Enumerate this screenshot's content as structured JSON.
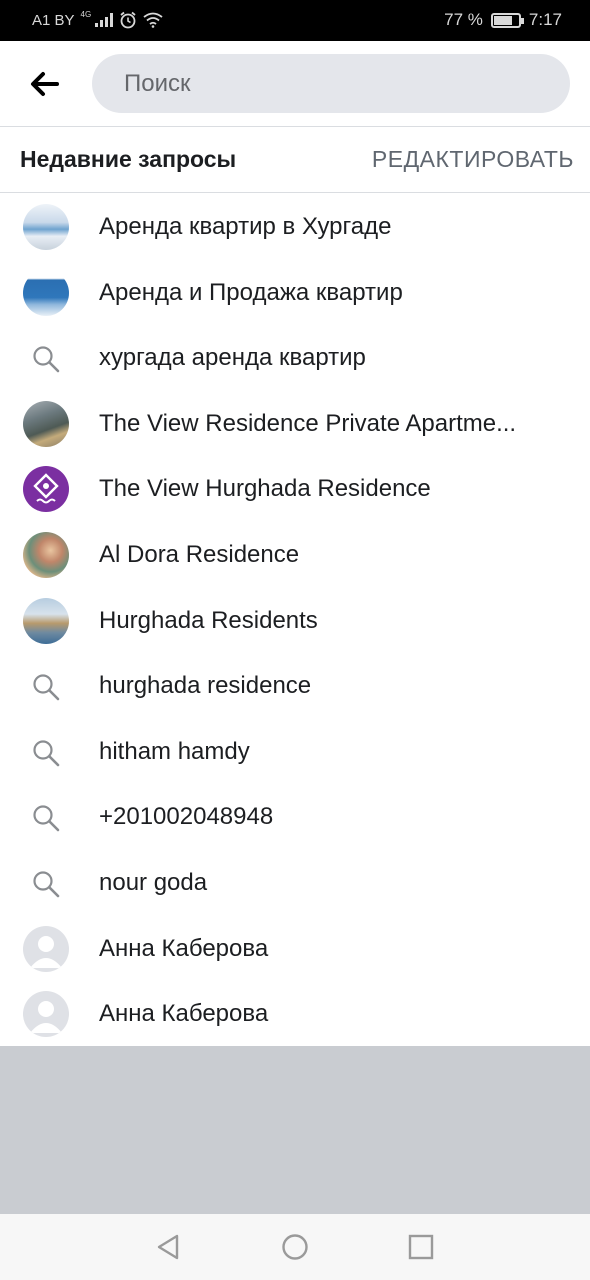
{
  "status_bar": {
    "carrier": "A1 BY",
    "network": "4G",
    "battery_percent": "77 %",
    "battery_level": 0.77,
    "time": "7:17",
    "icons": [
      "signal-icon",
      "alarm-icon",
      "wifi-icon",
      "battery-icon"
    ]
  },
  "search": {
    "back_icon": "arrow-left-icon",
    "placeholder": "Поиск",
    "value": ""
  },
  "recent": {
    "title": "Недавние запросы",
    "edit_label": "РЕДАКТИРОВАТЬ",
    "items": [
      {
        "label": "Аренда квартир в Хургаде",
        "kind": "page"
      },
      {
        "label": "Аренда и Продажа квартир",
        "kind": "page"
      },
      {
        "label": "хургада аренда квартир",
        "kind": "query"
      },
      {
        "label": "The View Residence Private Apartme...",
        "kind": "page"
      },
      {
        "label": "The View Hurghada Residence",
        "kind": "page"
      },
      {
        "label": "Al Dora Residence",
        "kind": "page"
      },
      {
        "label": "Hurghada Residents",
        "kind": "page"
      },
      {
        "label": "hurghada residence",
        "kind": "query"
      },
      {
        "label": "hitham hamdy",
        "kind": "query"
      },
      {
        "label": "+201002048948",
        "kind": "query"
      },
      {
        "label": "nour goda",
        "kind": "query"
      },
      {
        "label": "Анна Каберова",
        "kind": "person"
      },
      {
        "label": "Анна Каберова",
        "kind": "person"
      }
    ]
  },
  "nav_bar": {
    "icons": [
      "nav-back-icon",
      "nav-home-icon",
      "nav-recents-icon"
    ]
  },
  "colors": {
    "search_bg": "#e4e6eb",
    "empty_area": "#c9ccd1",
    "text_primary": "#1c1e21",
    "text_secondary": "#606770",
    "brand_purple": "#7b2fa1"
  }
}
